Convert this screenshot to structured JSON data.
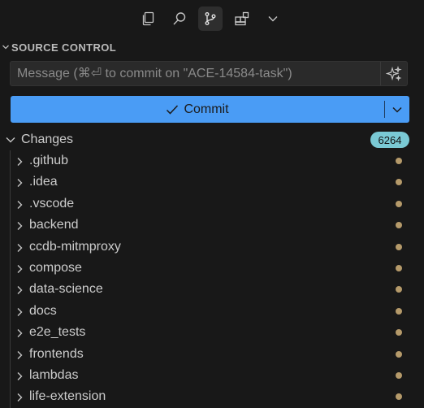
{
  "toolbar": {
    "icons": [
      "explorer-icon",
      "search-icon",
      "source-control-icon",
      "extensions-icon",
      "chevron-down-icon"
    ],
    "active": "source-control-icon"
  },
  "section": {
    "title": "SOURCE CONTROL"
  },
  "message": {
    "placeholder": "Message (⌘⏎ to commit on \"ACE-14584-task\")",
    "value": ""
  },
  "commit": {
    "label": "Commit"
  },
  "changes": {
    "label": "Changes",
    "count": "6264"
  },
  "tree": {
    "items": [
      {
        "name": ".github"
      },
      {
        "name": ".idea"
      },
      {
        "name": ".vscode"
      },
      {
        "name": "backend"
      },
      {
        "name": "ccdb-mitmproxy"
      },
      {
        "name": "compose"
      },
      {
        "name": "data-science"
      },
      {
        "name": "docs"
      },
      {
        "name": "e2e_tests"
      },
      {
        "name": "frontends"
      },
      {
        "name": "lambdas"
      },
      {
        "name": "life-extension"
      }
    ]
  },
  "colors": {
    "background": "#181818",
    "accent": "#4a9cf5",
    "badge": "#7ac9d4",
    "modified_dot": "#b59a6a"
  }
}
